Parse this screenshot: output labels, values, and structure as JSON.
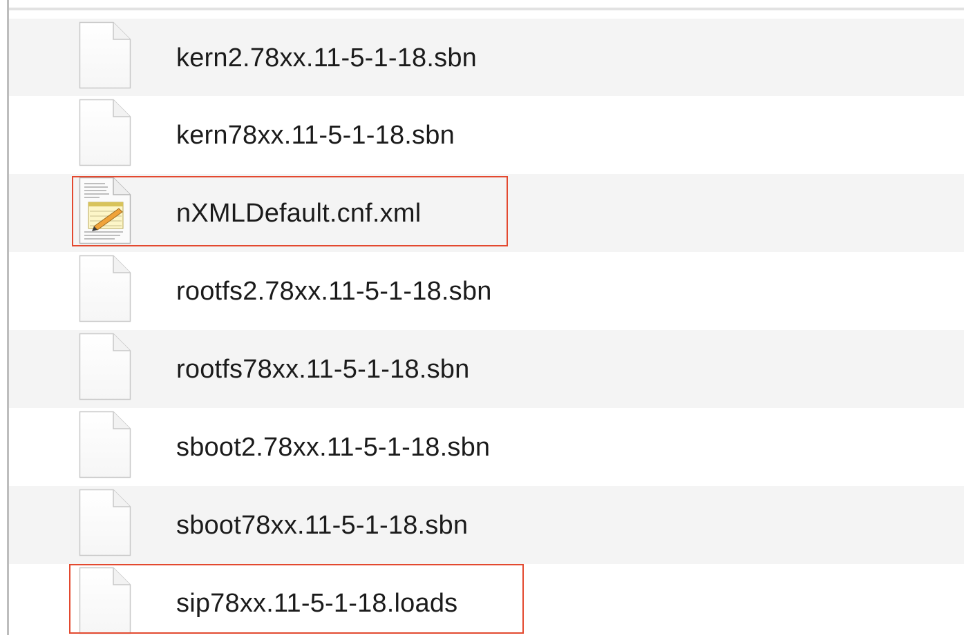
{
  "file_list": {
    "files": [
      {
        "name": "kern2.78xx.11-5-1-18.sbn",
        "icon": "blank-document-icon"
      },
      {
        "name": "kern78xx.11-5-1-18.sbn",
        "icon": "blank-document-icon"
      },
      {
        "name": "nXMLDefault.cnf.xml",
        "icon": "text-edit-document-icon"
      },
      {
        "name": "rootfs2.78xx.11-5-1-18.sbn",
        "icon": "blank-document-icon"
      },
      {
        "name": "rootfs78xx.11-5-1-18.sbn",
        "icon": "blank-document-icon"
      },
      {
        "name": "sboot2.78xx.11-5-1-18.sbn",
        "icon": "blank-document-icon"
      },
      {
        "name": "sboot78xx.11-5-1-18.sbn",
        "icon": "blank-document-icon"
      },
      {
        "name": "sip78xx.11-5-1-18.loads",
        "icon": "blank-document-icon"
      }
    ]
  },
  "highlights": [
    "nXMLDefault.cnf.xml",
    "sip78xx.11-5-1-18.loads"
  ],
  "colors": {
    "highlight_border": "#e3492f",
    "row_alt": "#f4f4f4"
  }
}
